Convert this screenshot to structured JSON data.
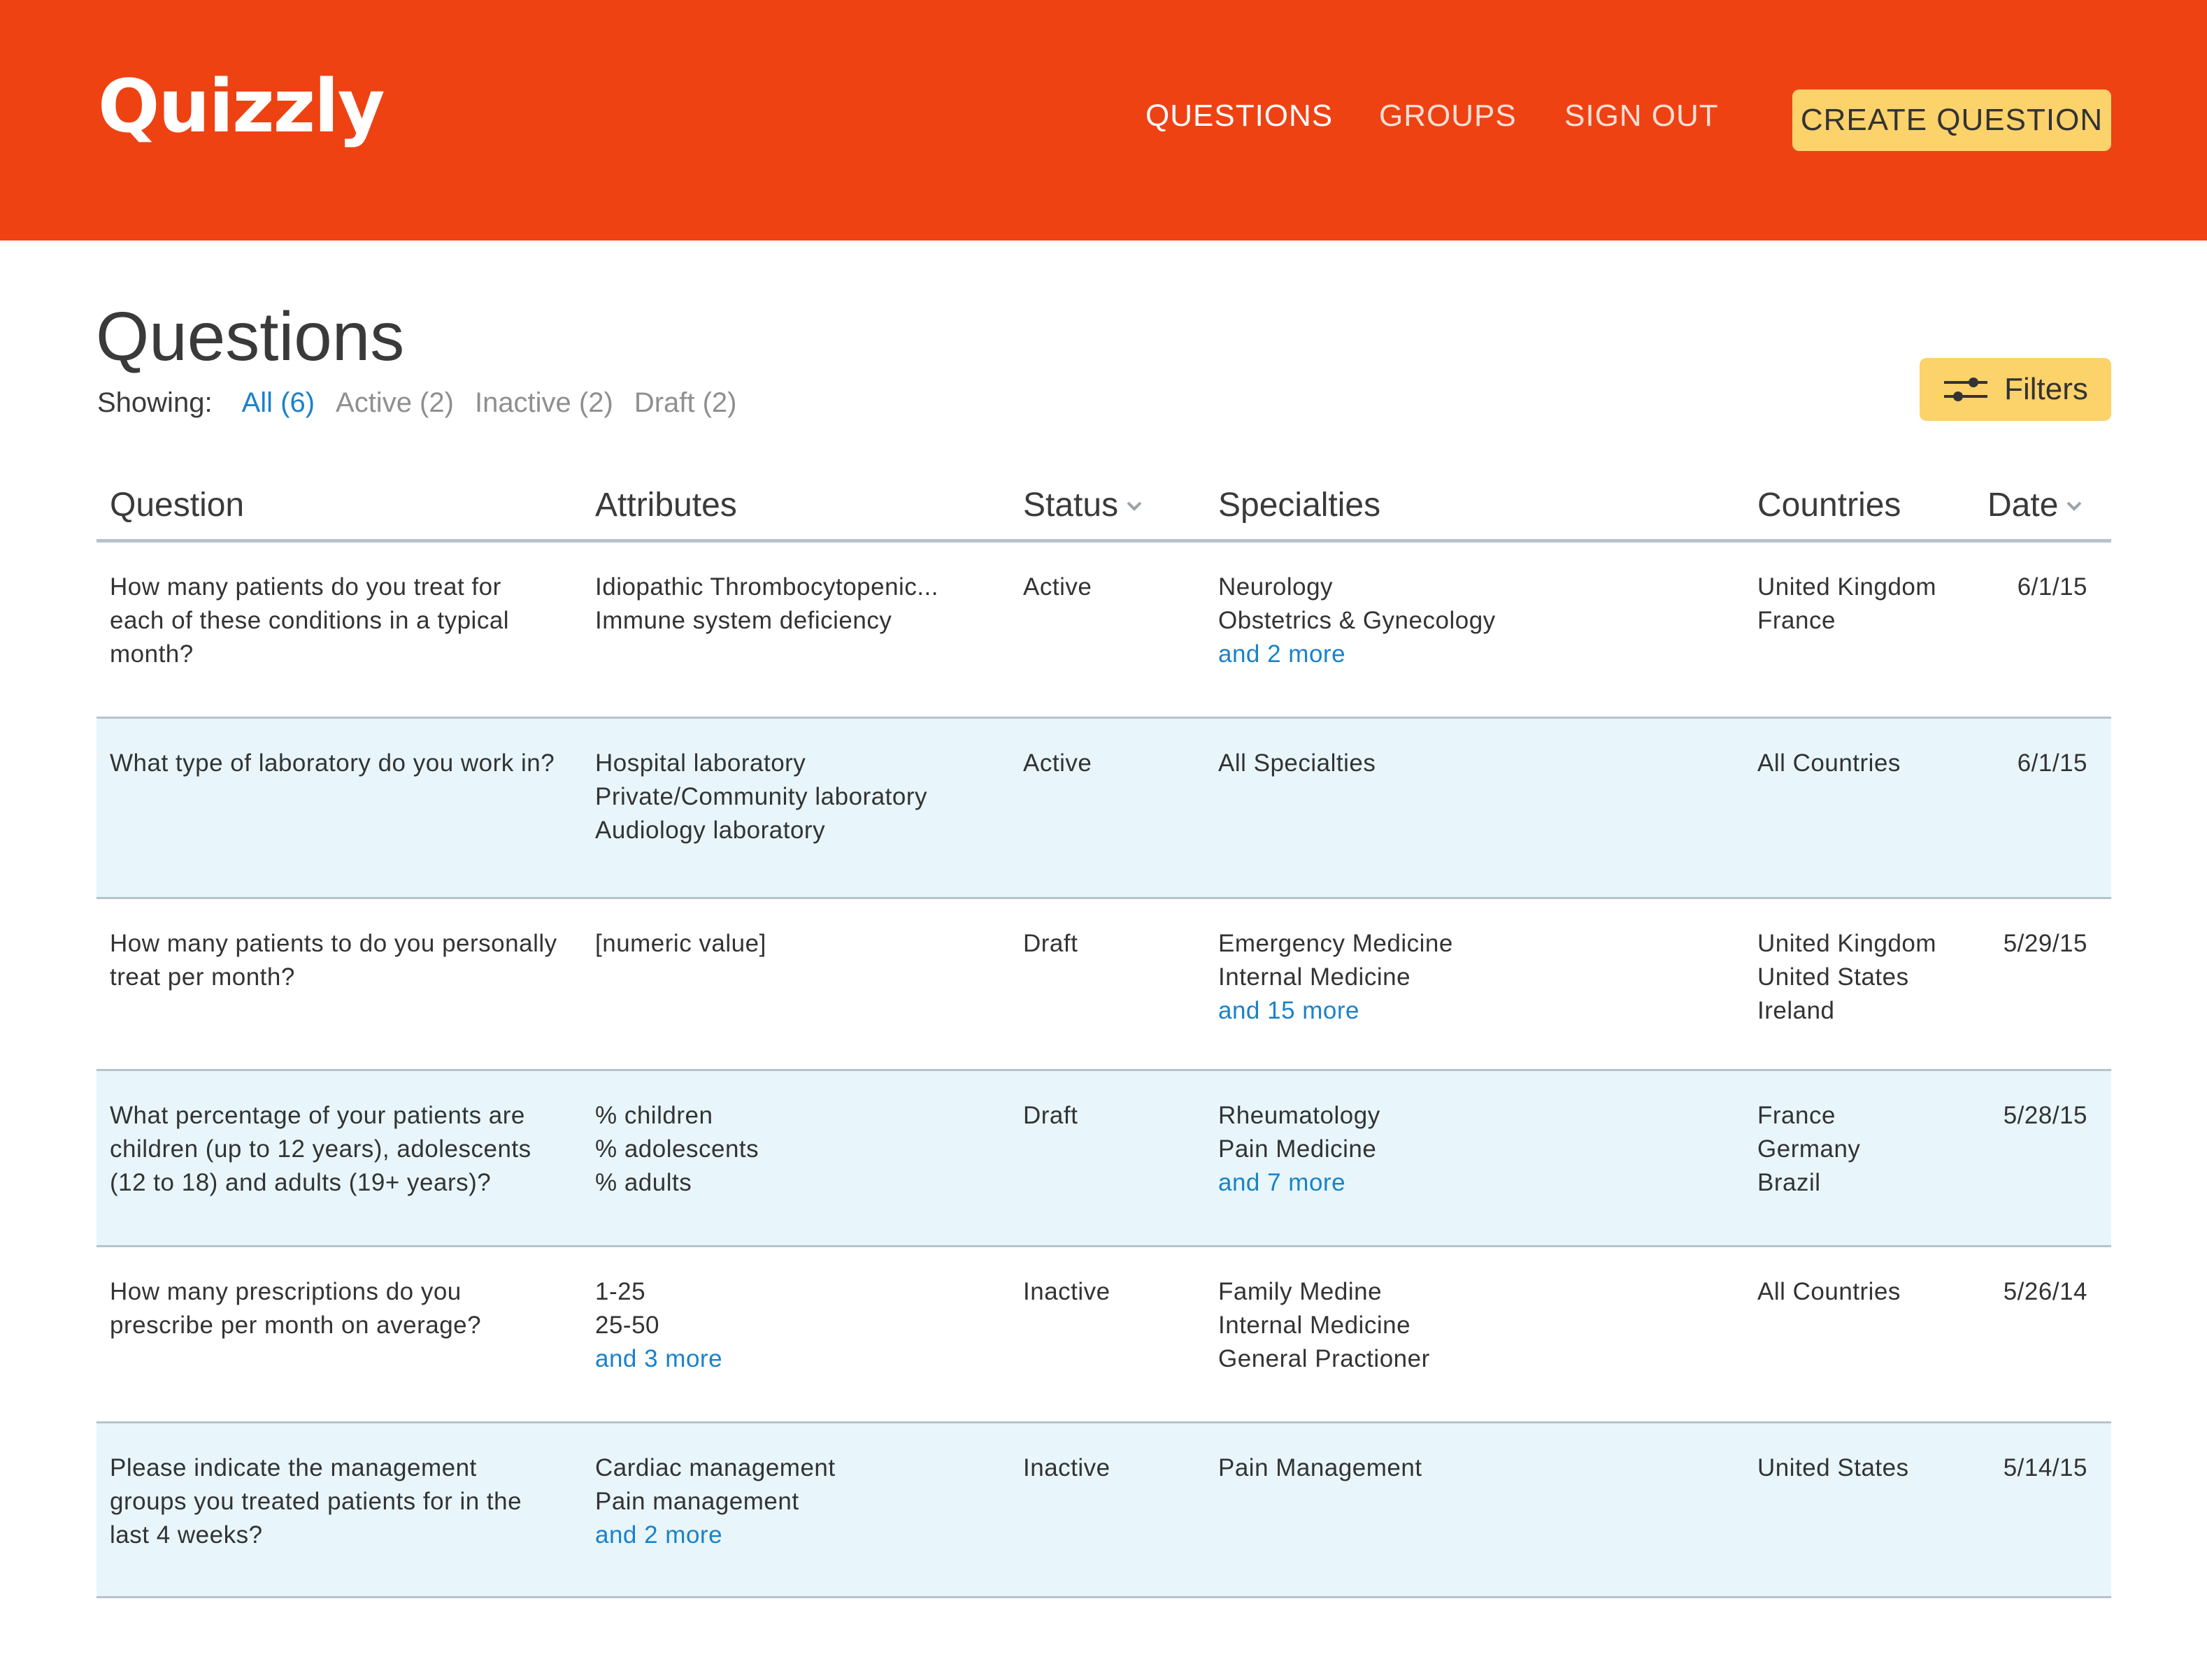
{
  "header": {
    "logo": "Quizzly",
    "nav": {
      "questions": "QUESTIONS",
      "groups": "GROUPS",
      "sign_out": "SIGN OUT"
    },
    "create_button": "CREATE QUESTION"
  },
  "page": {
    "title": "Questions",
    "showing_label": "Showing:",
    "filter_options": {
      "all": "All (6)",
      "active": "Active (2)",
      "inactive": "Inactive (2)",
      "draft": "Draft (2)"
    },
    "filters_button": "Filters"
  },
  "table": {
    "columns": {
      "question": "Question",
      "attributes": "Attributes",
      "status": "Status",
      "specialties": "Specialties",
      "countries": "Countries",
      "date": "Date"
    },
    "rows": [
      {
        "question": "How many patients do you treat for each of these conditions in a typical month?",
        "attributes": [
          "Idiopathic Thrombocytopenic...",
          "Immune system deficiency"
        ],
        "attributes_more": "",
        "status": "Active",
        "specialties": [
          "Neurology",
          "Obstetrics & Gynecology"
        ],
        "specialties_more": "and 2 more",
        "countries": [
          "United Kingdom",
          "France"
        ],
        "date": "6/1/15"
      },
      {
        "question": "What type of laboratory do you work in?",
        "attributes": [
          "Hospital laboratory",
          "Private/Community laboratory",
          "Audiology laboratory"
        ],
        "attributes_more": "",
        "status": "Active",
        "specialties": [
          "All Specialties"
        ],
        "specialties_more": "",
        "countries": [
          "All Countries"
        ],
        "date": "6/1/15"
      },
      {
        "question": "How many patients to do you personally treat per month?",
        "attributes": [
          "[numeric value]"
        ],
        "attributes_more": "",
        "status": "Draft",
        "specialties": [
          "Emergency Medicine",
          "Internal Medicine"
        ],
        "specialties_more": "and 15 more",
        "countries": [
          "United Kingdom",
          "United States",
          "Ireland"
        ],
        "date": "5/29/15"
      },
      {
        "question": "What percentage of your patients are children (up to 12 years), adolescents (12 to 18) and adults (19+ years)?",
        "attributes": [
          "% children",
          "% adolescents",
          "% adults"
        ],
        "attributes_more": "",
        "status": "Draft",
        "specialties": [
          "Rheumatology",
          "Pain Medicine"
        ],
        "specialties_more": "and 7 more",
        "countries": [
          "France",
          "Germany",
          "Brazil"
        ],
        "date": "5/28/15"
      },
      {
        "question": "How many prescriptions do you prescribe per month on average?",
        "attributes": [
          "1-25",
          "25-50"
        ],
        "attributes_more": "and 3 more",
        "status": "Inactive",
        "specialties": [
          "Family Medine",
          "Internal Medicine",
          "General Practioner"
        ],
        "specialties_more": "",
        "countries": [
          "All Countries"
        ],
        "date": "5/26/14"
      },
      {
        "question": "Please indicate the management groups you treated patients for in the last 4 weeks?",
        "attributes": [
          "Cardiac management",
          "Pain management"
        ],
        "attributes_more": "and 2 more",
        "status": "Inactive",
        "specialties": [
          "Pain Management"
        ],
        "specialties_more": "",
        "countries": [
          "United States"
        ],
        "date": "5/14/15"
      }
    ]
  },
  "colors": {
    "brand": "#ee4213",
    "button": "#fcd26b",
    "link": "#1a82c9",
    "row_shade": "#e8f6fb",
    "divider": "#b6c3cd"
  },
  "icons": {
    "filters": "sliders-icon",
    "sort": "chevron-down-icon"
  }
}
